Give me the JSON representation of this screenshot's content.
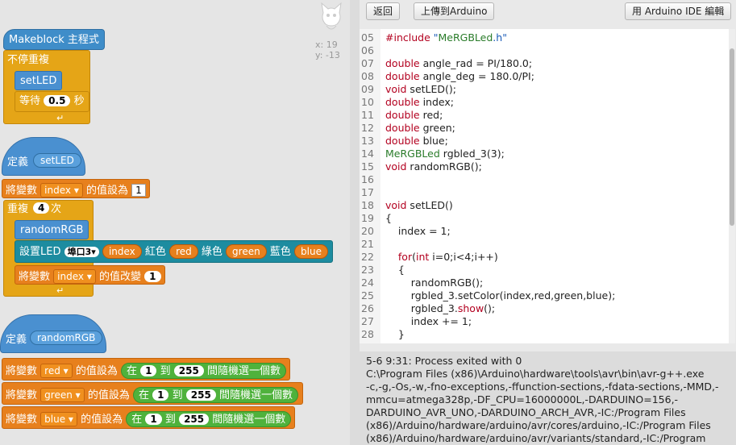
{
  "sprite_info": {
    "x_label": "x:",
    "x_value": "19",
    "y_label": "y:",
    "y_value": "-13"
  },
  "blocks": {
    "main_hat": "Makeblock 主程式",
    "forever": "不停重複",
    "call_setled": "setLED",
    "wait_prefix": "等待",
    "wait_value": "0.5",
    "wait_unit": "秒",
    "def1_label": "定義",
    "def1_name": "setLED",
    "set_index_prefix": "將變數",
    "set_index_var": "index",
    "set_index_mid": "的值設為",
    "set_index_value": "1",
    "repeat_prefix": "重複",
    "repeat_value": "4",
    "repeat_unit": "次",
    "call_random": "randomRGB",
    "setled_prefix": "設置LED",
    "setled_port": "埠口3",
    "setled_index": "index",
    "setled_red_label": "紅色",
    "setled_red": "red",
    "setled_green_label": "綠色",
    "setled_green": "green",
    "setled_blue_label": "藍色",
    "setled_blue": "blue",
    "change_prefix": "將變數",
    "change_var": "index",
    "change_mid": "的值改變",
    "change_value": "1",
    "def2_label": "定義",
    "def2_name": "randomRGB",
    "rand_rows": [
      {
        "prefix": "將變數",
        "var": "red",
        "mid": "的值設為",
        "at": "在",
        "from": "1",
        "to_label": "到",
        "to": "255",
        "suffix": "間隨機選一個數"
      },
      {
        "prefix": "將變數",
        "var": "green",
        "mid": "的值設為",
        "at": "在",
        "from": "1",
        "to_label": "到",
        "to": "255",
        "suffix": "間隨機選一個數"
      },
      {
        "prefix": "將變數",
        "var": "blue",
        "mid": "的值設為",
        "at": "在",
        "from": "1",
        "to_label": "到",
        "to": "255",
        "suffix": "間隨機選一個數"
      }
    ]
  },
  "toolbar": {
    "back": "返回",
    "upload": "上傳到Arduino",
    "open_ide": "用 Arduino IDE 編輯"
  },
  "code_lines": [
    {
      "n": "05",
      "t": "#include \"MeRGBLed.h\""
    },
    {
      "n": "06",
      "t": ""
    },
    {
      "n": "07",
      "t": "double angle_rad = PI/180.0;"
    },
    {
      "n": "08",
      "t": "double angle_deg = 180.0/PI;"
    },
    {
      "n": "09",
      "t": "void setLED();"
    },
    {
      "n": "10",
      "t": "double index;"
    },
    {
      "n": "11",
      "t": "double red;"
    },
    {
      "n": "12",
      "t": "double green;"
    },
    {
      "n": "13",
      "t": "double blue;"
    },
    {
      "n": "14",
      "t": "MeRGBLed rgbled_3(3);"
    },
    {
      "n": "15",
      "t": "void randomRGB();"
    },
    {
      "n": "16",
      "t": ""
    },
    {
      "n": "17",
      "t": ""
    },
    {
      "n": "18",
      "t": "void setLED()"
    },
    {
      "n": "19",
      "t": "{"
    },
    {
      "n": "20",
      "t": "    index = 1;"
    },
    {
      "n": "21",
      "t": ""
    },
    {
      "n": "22",
      "t": "    for(int i=0;i<4;i++)"
    },
    {
      "n": "23",
      "t": "    {"
    },
    {
      "n": "24",
      "t": "        randomRGB();"
    },
    {
      "n": "25",
      "t": "        rgbled_3.setColor(index,red,green,blue);"
    },
    {
      "n": "26",
      "t": "        rgbled_3.show();"
    },
    {
      "n": "27",
      "t": "        index += 1;"
    },
    {
      "n": "28",
      "t": "    }"
    }
  ],
  "console_lines": [
    "5-6 9:31: Process exited with 0",
    "C:\\Program Files (x86)\\Arduino\\hardware\\tools\\avr\\bin\\avr-g++.exe",
    "-c,-g,-Os,-w,-fno-exceptions,-ffunction-sections,-fdata-sections,-MMD,-",
    "mmcu=atmega328p,-DF_CPU=16000000L,-DARDUINO=156,-",
    "DARDUINO_AVR_UNO,-DARDUINO_ARCH_AVR,-IC:/Program Files",
    "(x86)/Arduino/hardware/arduino/avr/cores/arduino,-IC:/Program Files",
    "(x86)/Arduino/hardware/arduino/avr/variants/standard,-IC:/Program"
  ]
}
